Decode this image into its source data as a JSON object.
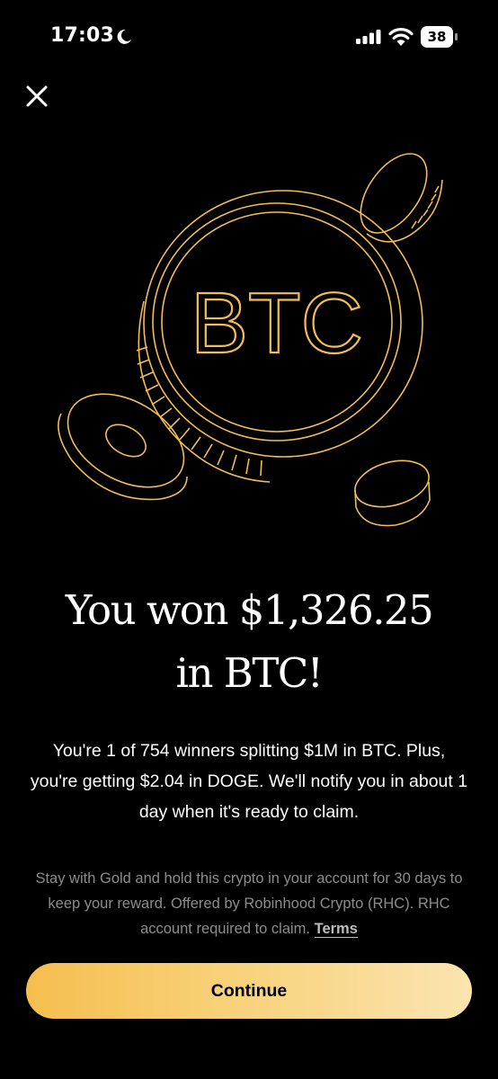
{
  "status_bar": {
    "time": "17:03",
    "battery_level": "38",
    "icons": [
      "moon-icon",
      "signal-icon",
      "wifi-icon",
      "battery-icon"
    ]
  },
  "close_icon": "close-icon",
  "illustration": {
    "coin_label": "BTC",
    "stroke_color": "#f2bc56"
  },
  "headline": {
    "line1": "You won $1,326.25",
    "line2": "in BTC!"
  },
  "body": "You're 1 of 754 winners splitting $1M in BTC. Plus, you're getting $2.04 in DOGE. We'll notify you in about 1 day when it's ready to claim.",
  "fine_print": {
    "text": "Stay with Gold and hold this crypto in your account for 30 days to keep your reward. Offered by Robinhood Crypto (RHC). RHC account required to claim. ",
    "link_label": "Terms"
  },
  "continue_button": {
    "label": "Continue",
    "gradient": [
      "#f6be4e",
      "#fbe4b0"
    ]
  }
}
